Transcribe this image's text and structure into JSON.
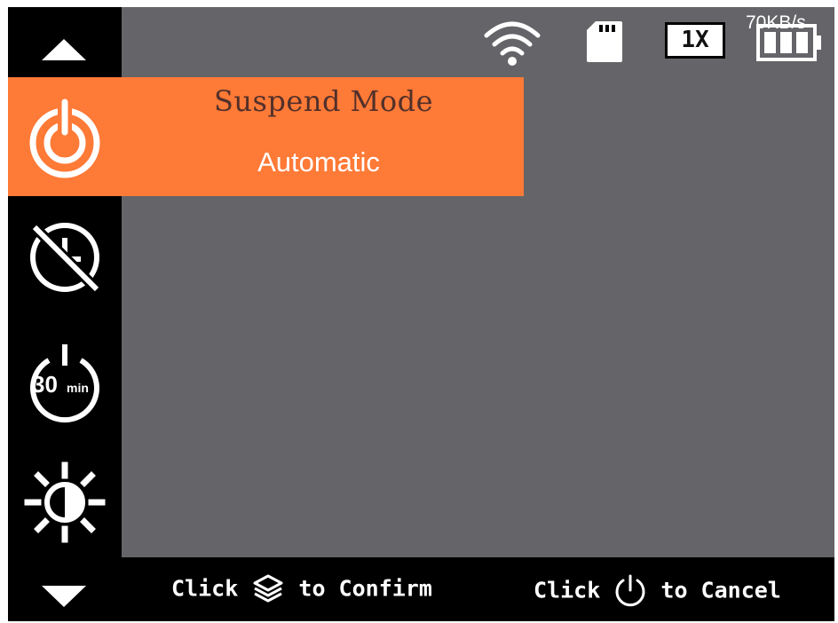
{
  "status_bar": {
    "wifi_icon": "wifi-icon",
    "sd_icon": "sd-card-icon",
    "zoom": "1X",
    "battery_icon": "battery-icon",
    "transfer_rate": "70KB/s"
  },
  "sidebar": {
    "items": [
      {
        "name": "scroll-up",
        "icon": "arrow-up-icon"
      },
      {
        "name": "suspend-mode",
        "icon": "power-icon",
        "selected": true
      },
      {
        "name": "timer-off",
        "icon": "timer-off-icon"
      },
      {
        "name": "auto-off-30min",
        "icon": "timer-30min-icon",
        "text": "30min"
      },
      {
        "name": "brightness",
        "icon": "brightness-icon"
      },
      {
        "name": "scroll-down",
        "icon": "arrow-down-icon"
      }
    ]
  },
  "popup": {
    "title": "Suspend Mode",
    "value": "Automatic"
  },
  "hints": {
    "confirm_prefix": "Click",
    "confirm_suffix": "to Confirm",
    "cancel_prefix": "Click",
    "cancel_suffix": "to Cancel"
  },
  "colors": {
    "accent": "#fe7a37",
    "title_text": "#52302a",
    "background": "#656468",
    "sidebar": "#000000"
  }
}
